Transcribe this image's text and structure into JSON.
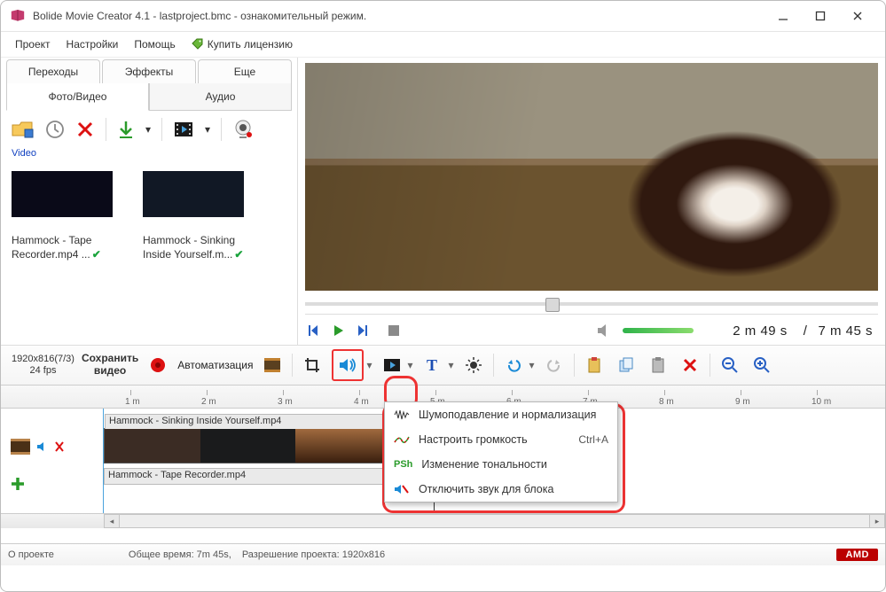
{
  "window": {
    "title": "Bolide Movie Creator 4.1 - lastproject.bmc  - ознакомительный режим."
  },
  "menu": {
    "project": "Проект",
    "settings": "Настройки",
    "help": "Помощь",
    "buy": "Купить лицензию"
  },
  "sidebar": {
    "tabs_top": [
      "Переходы",
      "Эффекты",
      "Еще"
    ],
    "tabs_main": [
      "Фото/Видео",
      "Аудио"
    ],
    "breadcrumb": "Video",
    "items": [
      {
        "name": "Hammock - Tape Recorder.mp4 ..."
      },
      {
        "name": "Hammock - Sinking Inside Yourself.m..."
      }
    ]
  },
  "player": {
    "current": "2 m 49 s",
    "sep": "/",
    "total": "7 m 45 s"
  },
  "toolbar2": {
    "resolution": "1920x816(7/3)",
    "fps": "24 fps",
    "save1": "Сохранить",
    "save2": "видео",
    "auto": "Автоматизация"
  },
  "timeline": {
    "marks": [
      "1 m",
      "2 m",
      "3 m",
      "4 m",
      "5 m",
      "6 m",
      "7 m",
      "8 m",
      "9 m",
      "10 m"
    ],
    "clip1": "Hammock - Sinking Inside Yourself.mp4",
    "clip2": "Hammock - Tape Recorder.mp4"
  },
  "audio_menu": {
    "items": [
      {
        "label": "Шумоподавление и нормализация",
        "shortcut": ""
      },
      {
        "label": "Настроить громкость",
        "shortcut": "Ctrl+A"
      },
      {
        "label": "Изменение тональности",
        "shortcut": ""
      },
      {
        "label": "Отключить звук для блока",
        "shortcut": ""
      }
    ]
  },
  "status": {
    "about": "О проекте",
    "total_time": "Общее время:  7m 45s,",
    "resolution": "Разрешение проекта:    1920x816",
    "badge": "AMD"
  }
}
